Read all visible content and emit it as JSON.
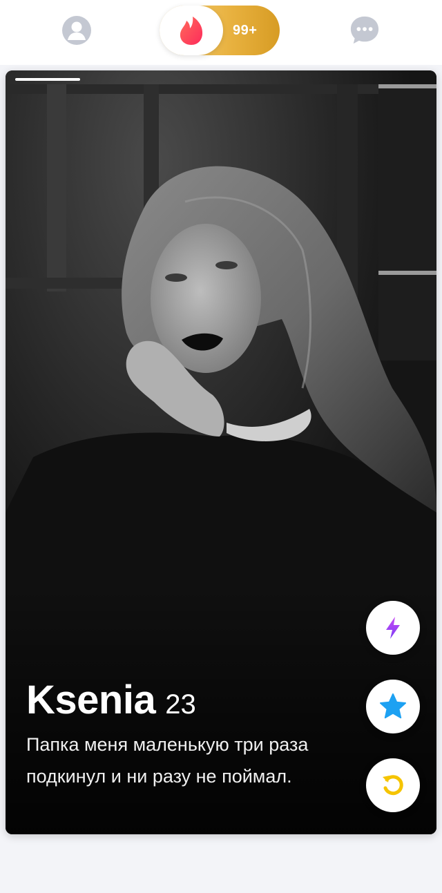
{
  "topbar": {
    "profile_icon": "person-icon",
    "center_icon": "flame-icon",
    "likes_count": "99+",
    "messages_icon": "chat-bubble-icon"
  },
  "card": {
    "name": "Ksenia",
    "age": "23",
    "bio": "Папка меня маленькую три раза подкинул и ни разу не поймал.",
    "photo_count_active": 1
  },
  "actions": [
    {
      "name": "boost",
      "icon": "lightning-icon",
      "color": "#a544f5"
    },
    {
      "name": "super-like",
      "icon": "star-icon",
      "color": "#1da1f2"
    },
    {
      "name": "rewind",
      "icon": "rewind-icon",
      "color": "#f5c400"
    }
  ],
  "colors": {
    "brand": "#fd4b5b",
    "gold": "#e8b13f",
    "background": "#f3f4f8"
  }
}
